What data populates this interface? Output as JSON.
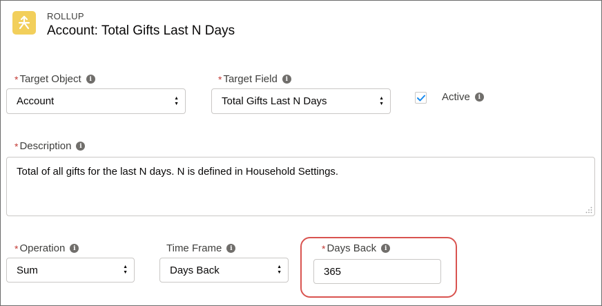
{
  "header": {
    "eyebrow": "ROLLUP",
    "title": "Account: Total Gifts Last N Days",
    "icon": "rollup-icon",
    "icon_color": "#f2cf5b"
  },
  "fields": {
    "target_object": {
      "label": "Target Object",
      "required": true,
      "value": "Account"
    },
    "target_field": {
      "label": "Target Field",
      "required": true,
      "value": "Total Gifts Last N Days"
    },
    "active": {
      "label": "Active",
      "checked": true
    },
    "description": {
      "label": "Description",
      "required": true,
      "value": "Total of all gifts for the last N days. N is defined in Household Settings."
    },
    "operation": {
      "label": "Operation",
      "required": true,
      "value": "Sum"
    },
    "time_frame": {
      "label": "Time Frame",
      "required": false,
      "value": "Days Back"
    },
    "days_back": {
      "label": "Days Back",
      "required": true,
      "value": "365"
    }
  },
  "symbols": {
    "required_marker": "*",
    "info_icon": "i"
  },
  "colors": {
    "required": "#c23934",
    "checkbox_check": "#1589ee",
    "highlight": "#d9534f"
  }
}
